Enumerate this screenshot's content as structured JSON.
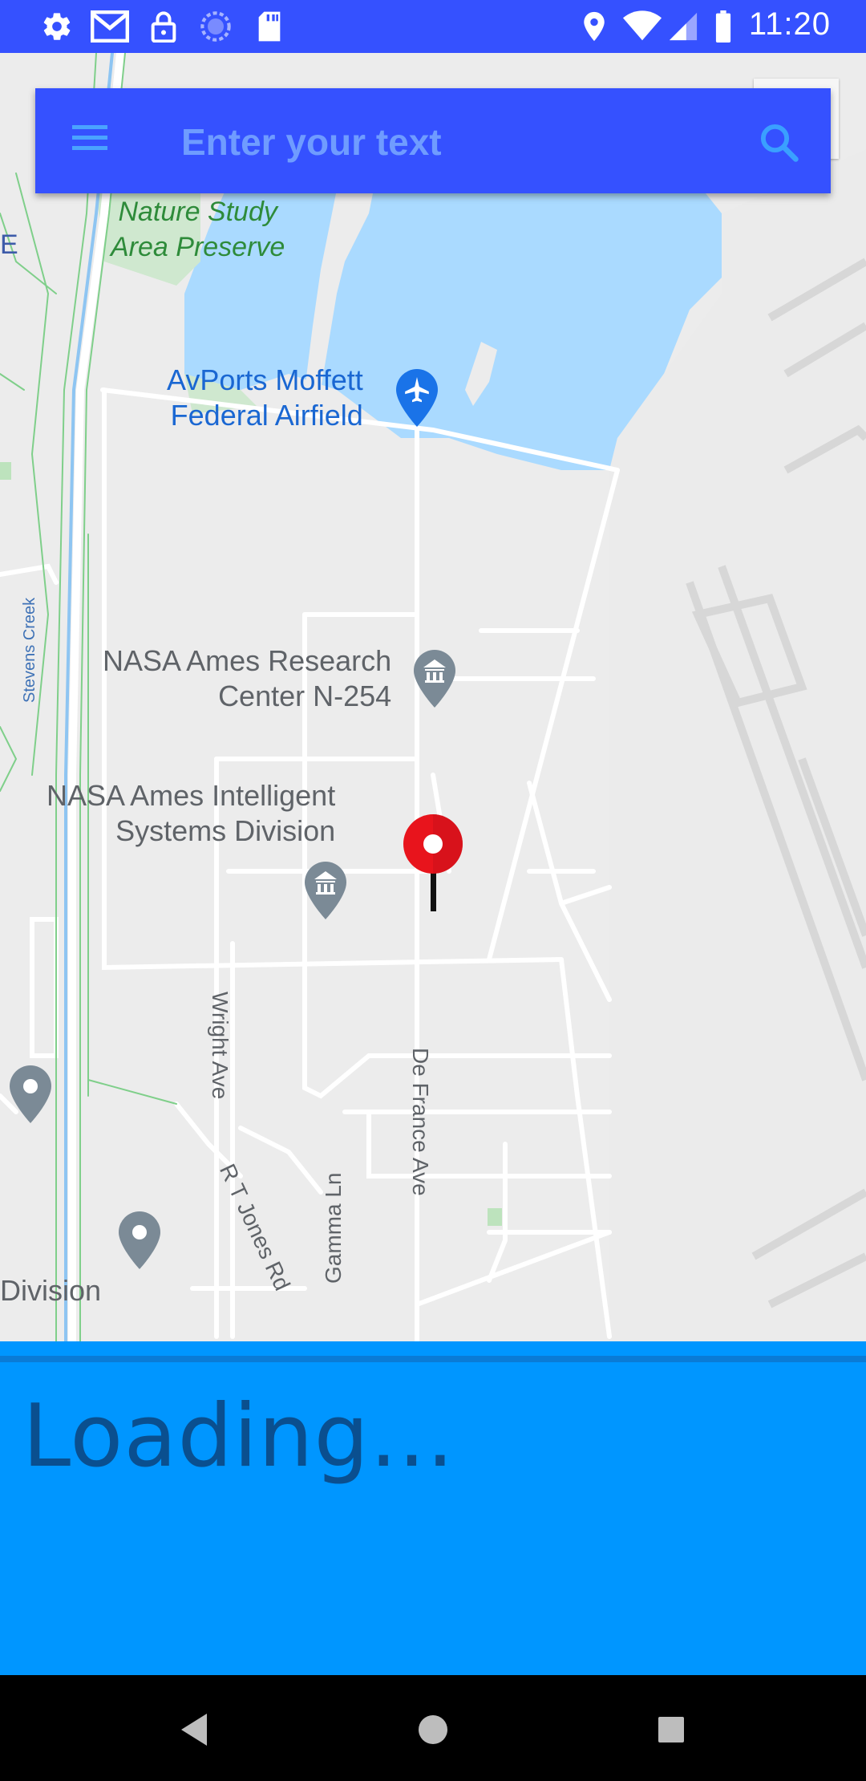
{
  "status_bar": {
    "time": "11:20",
    "icons": [
      "gear-icon",
      "gmail-icon",
      "lock-icon",
      "sync-icon",
      "sd-card-icon",
      "location-icon",
      "wifi-icon",
      "signal-icon",
      "battery-icon"
    ]
  },
  "search": {
    "placeholder": "Enter your text",
    "menu_icon": "hamburger-menu-icon",
    "search_icon": "search-icon"
  },
  "map": {
    "places": {
      "nature_preserve": "Nature Study\nArea Preserve",
      "airfield": "AvPorts Moffett\nFederal Airfield",
      "nasa_research": "NASA Ames Research\nCenter N-254",
      "nasa_intelligent": "NASA Ames Intelligent\nSystems Division",
      "division": "Division",
      "edge_letter": "E"
    },
    "streets": {
      "stevens_creek": "Stevens Creek",
      "wright_ave": "Wright Ave",
      "de_france_ave": "De France Ave",
      "rt_jones_rd": "R T Jones Rd",
      "gamma_ln": "Gamma Ln"
    }
  },
  "loading": {
    "text": "Loading..."
  },
  "nav": {
    "back": "back-icon",
    "home": "home-icon",
    "recents": "recents-icon"
  },
  "colors": {
    "accent": "#3551ff",
    "panel": "#0096ff",
    "pin": "#e8141c",
    "water": "#aadaff"
  }
}
